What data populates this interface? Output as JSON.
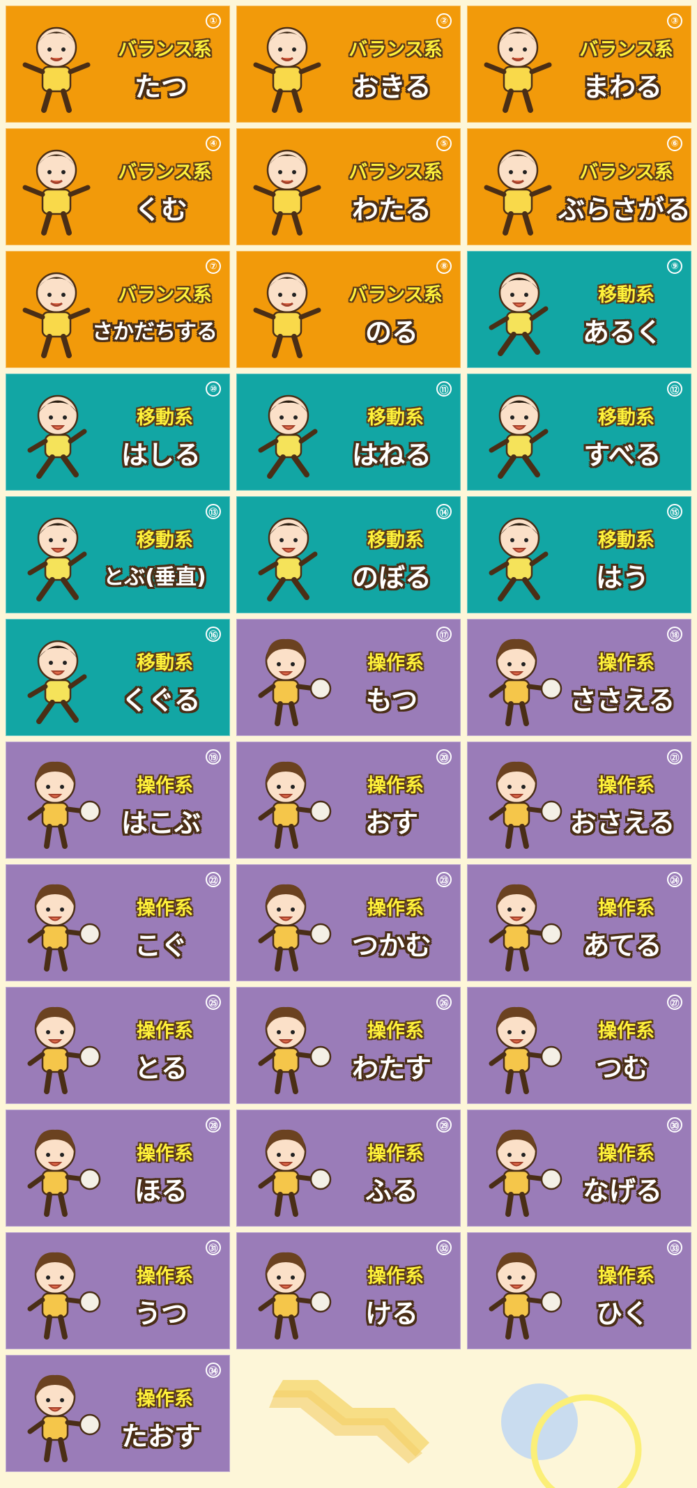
{
  "cards": [
    {
      "num": "①",
      "category": "バランス系",
      "verb": "たつ",
      "type": "balance"
    },
    {
      "num": "②",
      "category": "バランス系",
      "verb": "おきる",
      "type": "balance"
    },
    {
      "num": "③",
      "category": "バランス系",
      "verb": "まわる",
      "type": "balance"
    },
    {
      "num": "④",
      "category": "バランス系",
      "verb": "くむ",
      "type": "balance"
    },
    {
      "num": "⑤",
      "category": "バランス系",
      "verb": "わたる",
      "type": "balance"
    },
    {
      "num": "⑥",
      "category": "バランス系",
      "verb": "ぶらさがる",
      "type": "balance"
    },
    {
      "num": "⑦",
      "category": "バランス系",
      "verb": "さかだちする",
      "type": "balance"
    },
    {
      "num": "⑧",
      "category": "バランス系",
      "verb": "のる",
      "type": "balance"
    },
    {
      "num": "⑨",
      "category": "移動系",
      "verb": "あるく",
      "type": "move"
    },
    {
      "num": "⑩",
      "category": "移動系",
      "verb": "はしる",
      "type": "move"
    },
    {
      "num": "⑪",
      "category": "移動系",
      "verb": "はねる",
      "type": "move"
    },
    {
      "num": "⑫",
      "category": "移動系",
      "verb": "すべる",
      "type": "move"
    },
    {
      "num": "⑬",
      "category": "移動系",
      "verb": "とぶ(垂直)",
      "type": "move"
    },
    {
      "num": "⑭",
      "category": "移動系",
      "verb": "のぼる",
      "type": "move"
    },
    {
      "num": "⑮",
      "category": "移動系",
      "verb": "はう",
      "type": "move"
    },
    {
      "num": "⑯",
      "category": "移動系",
      "verb": "くぐる",
      "type": "move"
    },
    {
      "num": "⑰",
      "category": "操作系",
      "verb": "もつ",
      "type": "operate"
    },
    {
      "num": "⑱",
      "category": "操作系",
      "verb": "ささえる",
      "type": "operate"
    },
    {
      "num": "⑲",
      "category": "操作系",
      "verb": "はこぶ",
      "type": "operate"
    },
    {
      "num": "⑳",
      "category": "操作系",
      "verb": "おす",
      "type": "operate"
    },
    {
      "num": "㉑",
      "category": "操作系",
      "verb": "おさえる",
      "type": "operate"
    },
    {
      "num": "㉒",
      "category": "操作系",
      "verb": "こぐ",
      "type": "operate"
    },
    {
      "num": "㉓",
      "category": "操作系",
      "verb": "つかむ",
      "type": "operate"
    },
    {
      "num": "㉔",
      "category": "操作系",
      "verb": "あてる",
      "type": "operate"
    },
    {
      "num": "㉕",
      "category": "操作系",
      "verb": "とる",
      "type": "operate"
    },
    {
      "num": "㉖",
      "category": "操作系",
      "verb": "わたす",
      "type": "operate"
    },
    {
      "num": "㉗",
      "category": "操作系",
      "verb": "つむ",
      "type": "operate"
    },
    {
      "num": "㉘",
      "category": "操作系",
      "verb": "ほる",
      "type": "operate"
    },
    {
      "num": "㉙",
      "category": "操作系",
      "verb": "ふる",
      "type": "operate"
    },
    {
      "num": "㉚",
      "category": "操作系",
      "verb": "なげる",
      "type": "operate"
    },
    {
      "num": "㉛",
      "category": "操作系",
      "verb": "うつ",
      "type": "operate"
    },
    {
      "num": "㉜",
      "category": "操作系",
      "verb": "ける",
      "type": "operate"
    },
    {
      "num": "㉝",
      "category": "操作系",
      "verb": "ひく",
      "type": "operate"
    },
    {
      "num": "㉞",
      "category": "操作系",
      "verb": "たおす",
      "type": "operate"
    }
  ],
  "colors": {
    "balance": "#f29a0a",
    "move": "#12a6a4",
    "operate": "#9a7cb8",
    "page_background": "#fdf6d8",
    "category_text": "#fff23a"
  }
}
